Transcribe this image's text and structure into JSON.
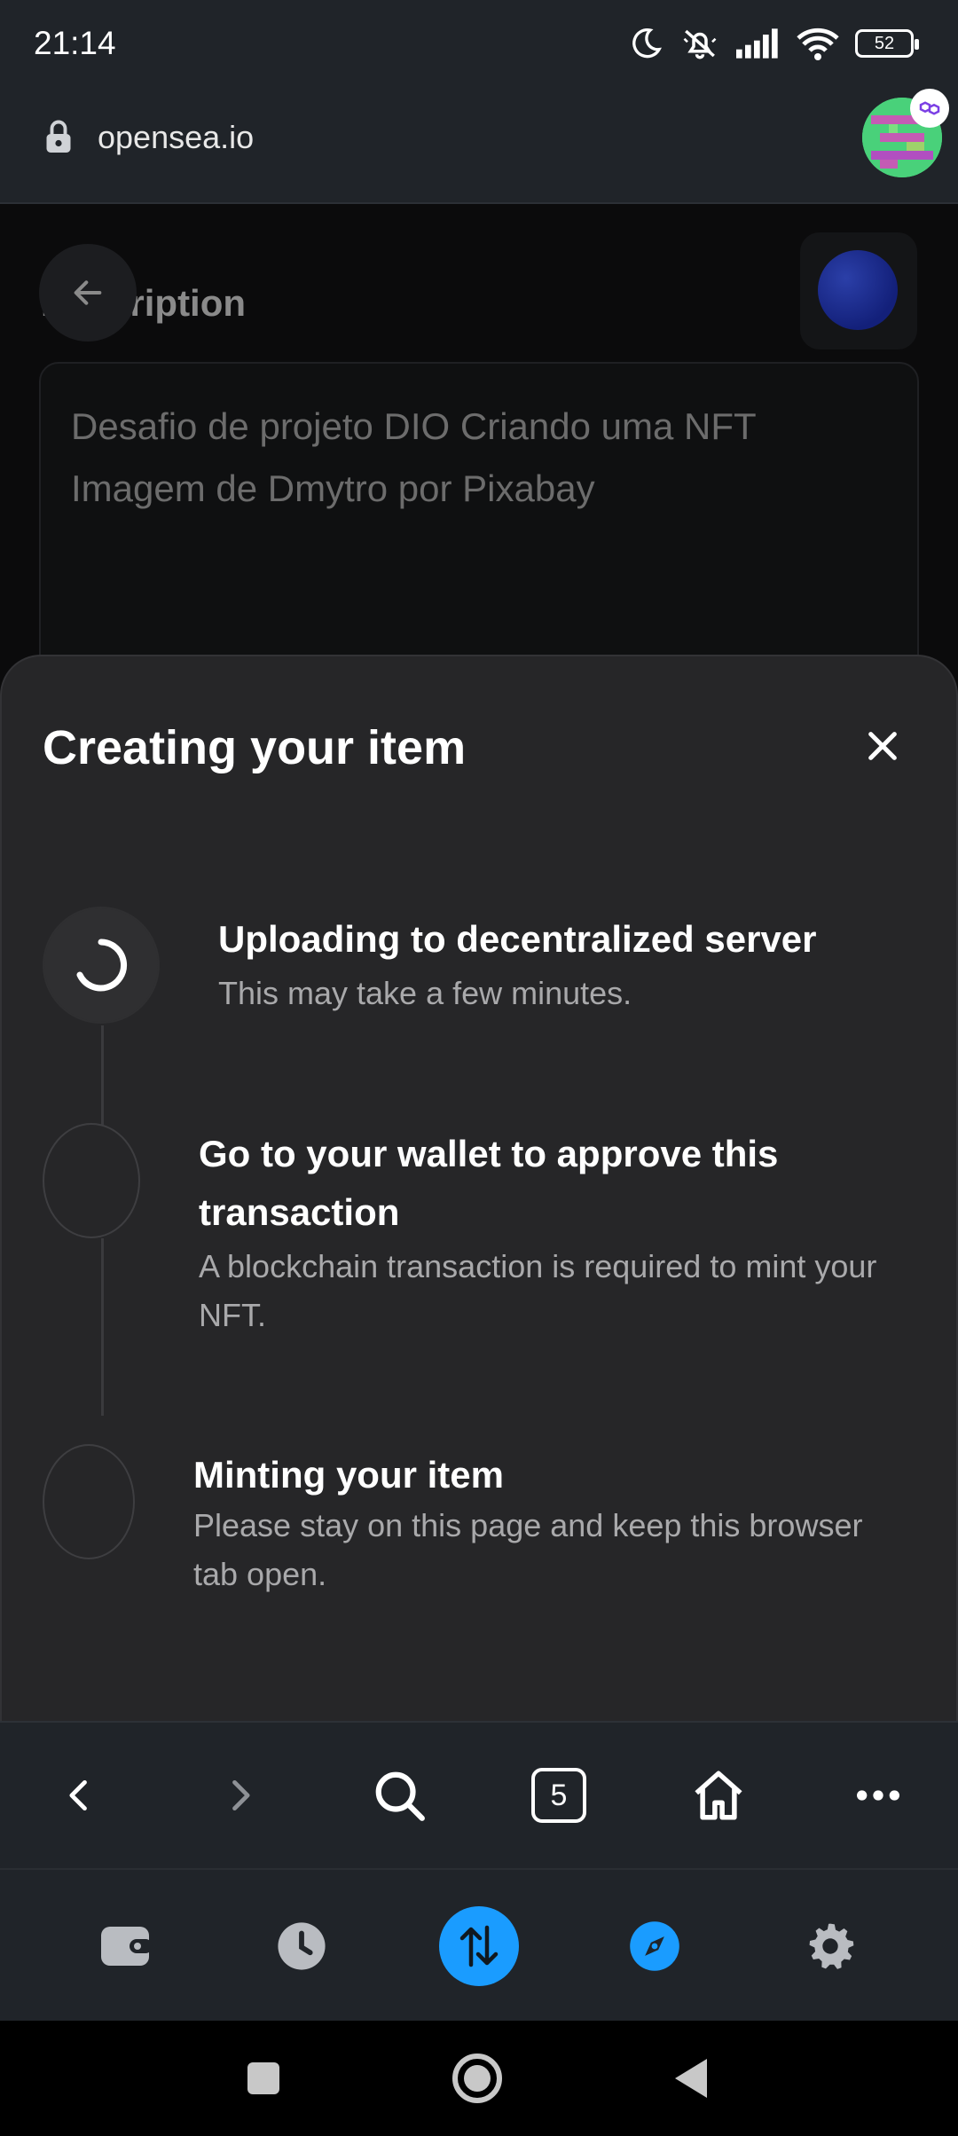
{
  "status_bar": {
    "time": "21:14",
    "battery": "52",
    "icons": [
      "moon-icon",
      "silent-icon",
      "signal-icon",
      "wifi-icon",
      "battery-icon"
    ]
  },
  "url_bar": {
    "url": "opensea.io",
    "icons": [
      "lock-icon",
      "profile-avatar"
    ]
  },
  "page": {
    "heading": "Description",
    "description": "Desafio de projeto DIO Criando uma NFT\nImagem de Dmytro por Pixabay"
  },
  "modal": {
    "title": "Creating your item",
    "steps": [
      {
        "title": "Uploading to decentralized server",
        "description": "This may take a few minutes.",
        "state": "in-progress"
      },
      {
        "title": "Go to your wallet to approve this transaction",
        "description": "A blockchain transaction is required to mint your NFT.",
        "state": "pending"
      },
      {
        "title": "Minting your item",
        "description": "Please stay on this page and keep this browser tab open.",
        "state": "pending"
      }
    ]
  },
  "toolbar": {
    "tab_count": "5",
    "icons": [
      "back-icon",
      "forward-icon",
      "search-icon",
      "tabs-icon",
      "home-icon",
      "more-icon"
    ]
  },
  "bottom_nav": {
    "icons": [
      "wallet-icon",
      "history-icon",
      "swap-icon",
      "explore-icon",
      "settings-icon"
    ],
    "accent": "#1a9cff"
  },
  "colors": {
    "sheet_background": "#262628",
    "chrome_background": "#202429"
  }
}
